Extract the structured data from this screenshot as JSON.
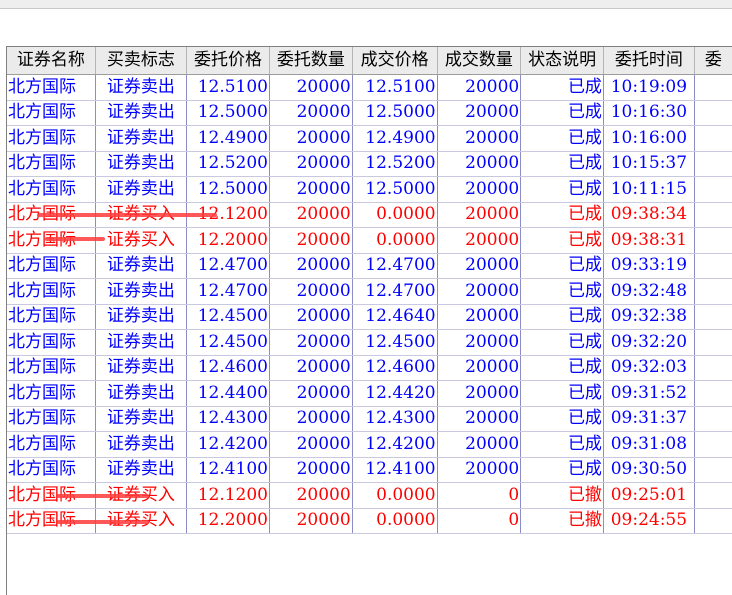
{
  "columns": [
    "证券名称",
    "买卖标志",
    "委托价格",
    "委托数量",
    "成交价格",
    "成交数量",
    "状态说明",
    "委托时间",
    "委"
  ],
  "rows": [
    {
      "name": "北方国际",
      "flag": "证券卖出",
      "price": "12.5100",
      "qty": "20000",
      "deal_price": "12.5100",
      "deal_qty": "20000",
      "status": "已成",
      "time": "10:19:09",
      "side": "sell"
    },
    {
      "name": "北方国际",
      "flag": "证券卖出",
      "price": "12.5000",
      "qty": "20000",
      "deal_price": "12.5000",
      "deal_qty": "20000",
      "status": "已成",
      "time": "10:16:30",
      "side": "sell"
    },
    {
      "name": "北方国际",
      "flag": "证券卖出",
      "price": "12.4900",
      "qty": "20000",
      "deal_price": "12.4900",
      "deal_qty": "20000",
      "status": "已成",
      "time": "10:16:00",
      "side": "sell"
    },
    {
      "name": "北方国际",
      "flag": "证券卖出",
      "price": "12.5200",
      "qty": "20000",
      "deal_price": "12.5200",
      "deal_qty": "20000",
      "status": "已成",
      "time": "10:15:37",
      "side": "sell"
    },
    {
      "name": "北方国际",
      "flag": "证券卖出",
      "price": "12.5000",
      "qty": "20000",
      "deal_price": "12.5000",
      "deal_qty": "20000",
      "status": "已成",
      "time": "10:11:15",
      "side": "sell"
    },
    {
      "name": "北方国际",
      "flag": "证券买入",
      "price": "12.1200",
      "qty": "20000",
      "deal_price": "0.0000",
      "deal_qty": "20000",
      "status": "已成",
      "time": "09:38:34",
      "side": "buy"
    },
    {
      "name": "北方国际",
      "flag": "证券买入",
      "price": "12.2000",
      "qty": "20000",
      "deal_price": "0.0000",
      "deal_qty": "20000",
      "status": "已成",
      "time": "09:38:31",
      "side": "buy"
    },
    {
      "name": "北方国际",
      "flag": "证券卖出",
      "price": "12.4700",
      "qty": "20000",
      "deal_price": "12.4700",
      "deal_qty": "20000",
      "status": "已成",
      "time": "09:33:19",
      "side": "sell"
    },
    {
      "name": "北方国际",
      "flag": "证券卖出",
      "price": "12.4700",
      "qty": "20000",
      "deal_price": "12.4700",
      "deal_qty": "20000",
      "status": "已成",
      "time": "09:32:48",
      "side": "sell"
    },
    {
      "name": "北方国际",
      "flag": "证券卖出",
      "price": "12.4500",
      "qty": "20000",
      "deal_price": "12.4640",
      "deal_qty": "20000",
      "status": "已成",
      "time": "09:32:38",
      "side": "sell"
    },
    {
      "name": "北方国际",
      "flag": "证券卖出",
      "price": "12.4500",
      "qty": "20000",
      "deal_price": "12.4500",
      "deal_qty": "20000",
      "status": "已成",
      "time": "09:32:20",
      "side": "sell"
    },
    {
      "name": "北方国际",
      "flag": "证券卖出",
      "price": "12.4600",
      "qty": "20000",
      "deal_price": "12.4600",
      "deal_qty": "20000",
      "status": "已成",
      "time": "09:32:03",
      "side": "sell"
    },
    {
      "name": "北方国际",
      "flag": "证券卖出",
      "price": "12.4400",
      "qty": "20000",
      "deal_price": "12.4420",
      "deal_qty": "20000",
      "status": "已成",
      "time": "09:31:52",
      "side": "sell"
    },
    {
      "name": "北方国际",
      "flag": "证券卖出",
      "price": "12.4300",
      "qty": "20000",
      "deal_price": "12.4300",
      "deal_qty": "20000",
      "status": "已成",
      "time": "09:31:37",
      "side": "sell"
    },
    {
      "name": "北方国际",
      "flag": "证券卖出",
      "price": "12.4200",
      "qty": "20000",
      "deal_price": "12.4200",
      "deal_qty": "20000",
      "status": "已成",
      "time": "09:31:08",
      "side": "sell"
    },
    {
      "name": "北方国际",
      "flag": "证券卖出",
      "price": "12.4100",
      "qty": "20000",
      "deal_price": "12.4100",
      "deal_qty": "20000",
      "status": "已成",
      "time": "09:30:50",
      "side": "sell"
    },
    {
      "name": "北方国际",
      "flag": "证券买入",
      "price": "12.1200",
      "qty": "20000",
      "deal_price": "0.0000",
      "deal_qty": "0",
      "status": "已撤",
      "time": "09:25:01",
      "side": "buy"
    },
    {
      "name": "北方国际",
      "flag": "证券买入",
      "price": "12.2000",
      "qty": "20000",
      "deal_price": "0.0000",
      "deal_qty": "0",
      "status": "已撤",
      "time": "09:24:55",
      "side": "buy"
    }
  ],
  "colors": {
    "sell": "#0000ff",
    "buy": "#ff0000",
    "annotation": "#ff3b3b"
  }
}
